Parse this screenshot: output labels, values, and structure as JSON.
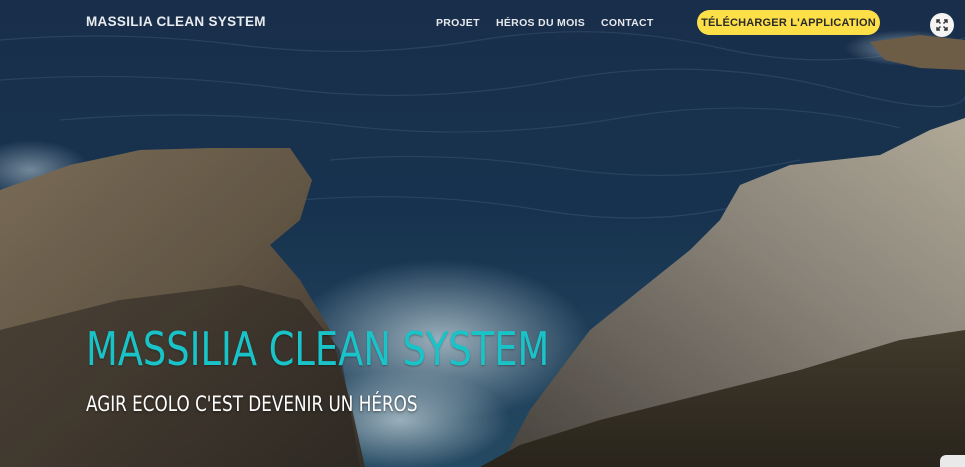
{
  "nav": {
    "brand": "MASSILIA CLEAN SYSTEM",
    "links": [
      "PROJET",
      "HÉROS DU MOIS",
      "CONTACT"
    ],
    "cta_label": "TÉLÉCHARGER L'APPLICATION",
    "fullscreen_icon": "expand-icon"
  },
  "hero": {
    "title": "MASSILIA CLEAN SYSTEM",
    "subtitle": "AGIR ECOLO C'EST DEVENIR UN HÉROS",
    "background": "rocky-coast-sea-photo"
  },
  "colors": {
    "accent_title": "#19c4c9",
    "cta_background": "#fde047",
    "sea": "#1e3552"
  }
}
